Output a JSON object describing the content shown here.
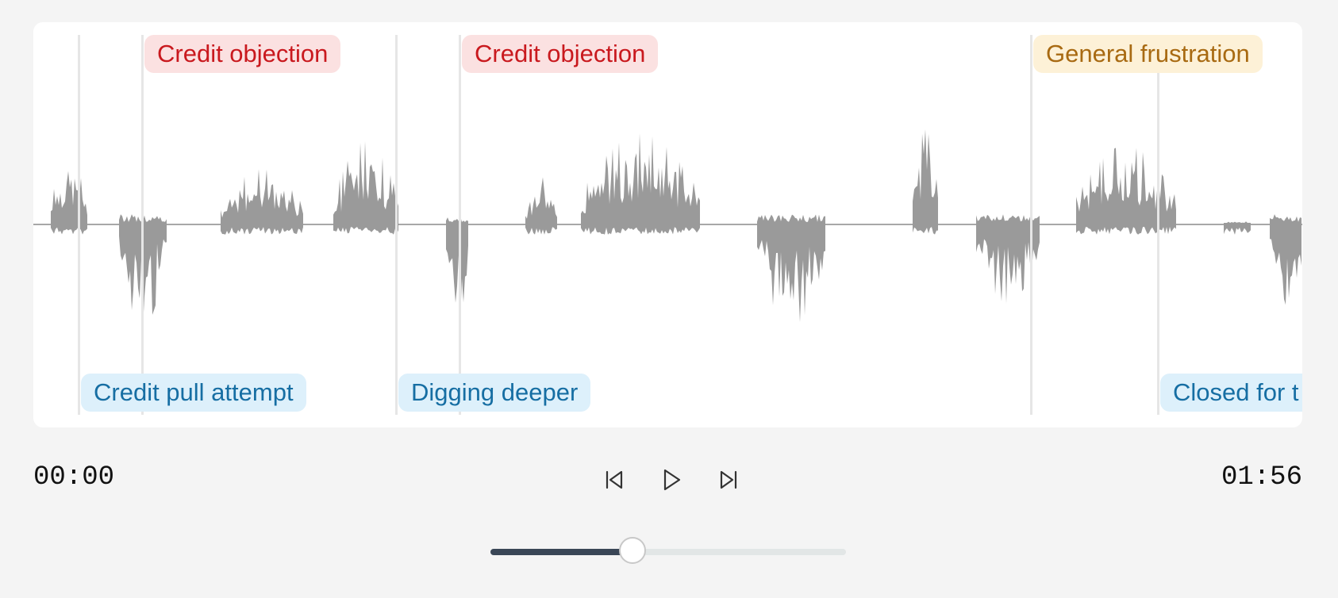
{
  "player": {
    "current_time": "00:00",
    "total_time": "01:56",
    "progress": 0.4
  },
  "labels_top": [
    {
      "text": "Credit objection",
      "kind": "red"
    },
    {
      "text": "Credit objection",
      "kind": "red"
    },
    {
      "text": "General frustration",
      "kind": "amber"
    }
  ],
  "labels_bottom": [
    {
      "text": "Credit pull attempt",
      "kind": "blue"
    },
    {
      "text": "Digging deeper",
      "kind": "blue"
    },
    {
      "text": "Closed for t",
      "kind": "blue"
    }
  ],
  "icons": {
    "prev": "skip-back-icon",
    "play": "play-icon",
    "next": "skip-forward-icon"
  },
  "colors": {
    "waveform": "#9a9a9a",
    "red_tag_bg": "#fbe1e1",
    "red_tag_text": "#c9191e",
    "amber_tag_bg": "#fdf1d7",
    "amber_tag_text": "#a86a12",
    "blue_tag_bg": "#ddf0fb",
    "blue_tag_text": "#166ea3",
    "progress_fill": "#3a4656"
  }
}
